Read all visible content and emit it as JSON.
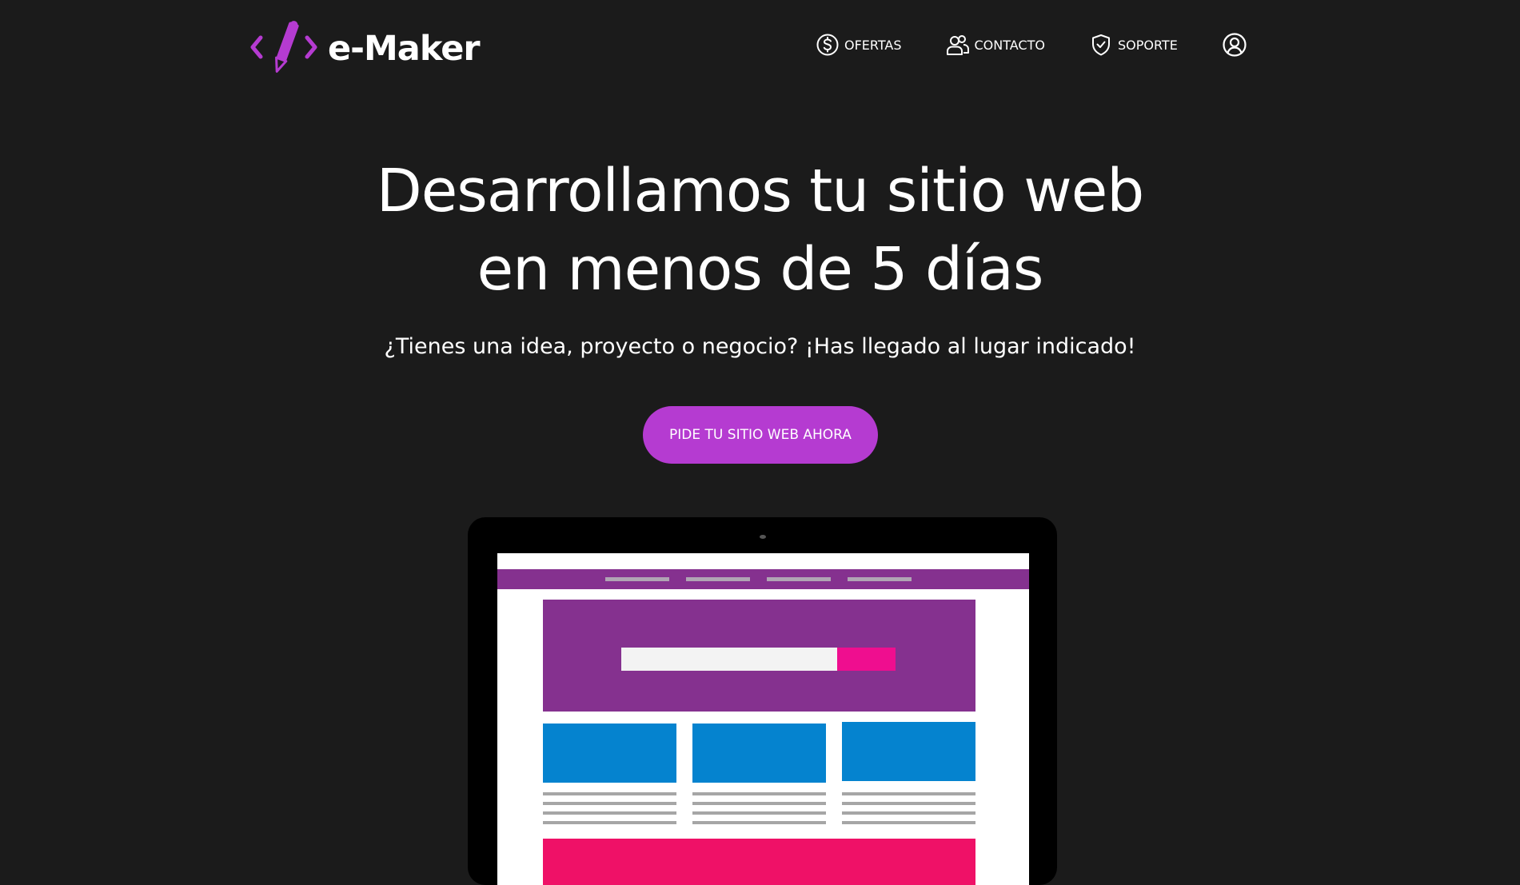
{
  "brand": {
    "name": "e-Maker",
    "accent_color": "#b53bd1"
  },
  "nav": {
    "items": [
      {
        "label": "OFERTAS",
        "icon": "dollar-circle-icon"
      },
      {
        "label": "CONTACTO",
        "icon": "users-icon"
      },
      {
        "label": "SOPORTE",
        "icon": "shield-check-icon"
      }
    ],
    "account_icon": "user-circle-icon"
  },
  "hero": {
    "title_line1": "Desarrollamos tu sitio web",
    "title_line2": "en menos de 5 días",
    "subtitle": "¿Tienes una idea, proyecto o negocio? ¡Has llegado al lugar indicado!",
    "cta_label": "PIDE TU SITIO WEB AHORA"
  },
  "illustration": {
    "name": "laptop-website-mockup",
    "colors": {
      "frame": "#000000",
      "nav": "#85318f",
      "hero": "#85318f",
      "search_button": "#ef0e8f",
      "cards": "#0583cf",
      "footer": "#ef1167"
    }
  }
}
